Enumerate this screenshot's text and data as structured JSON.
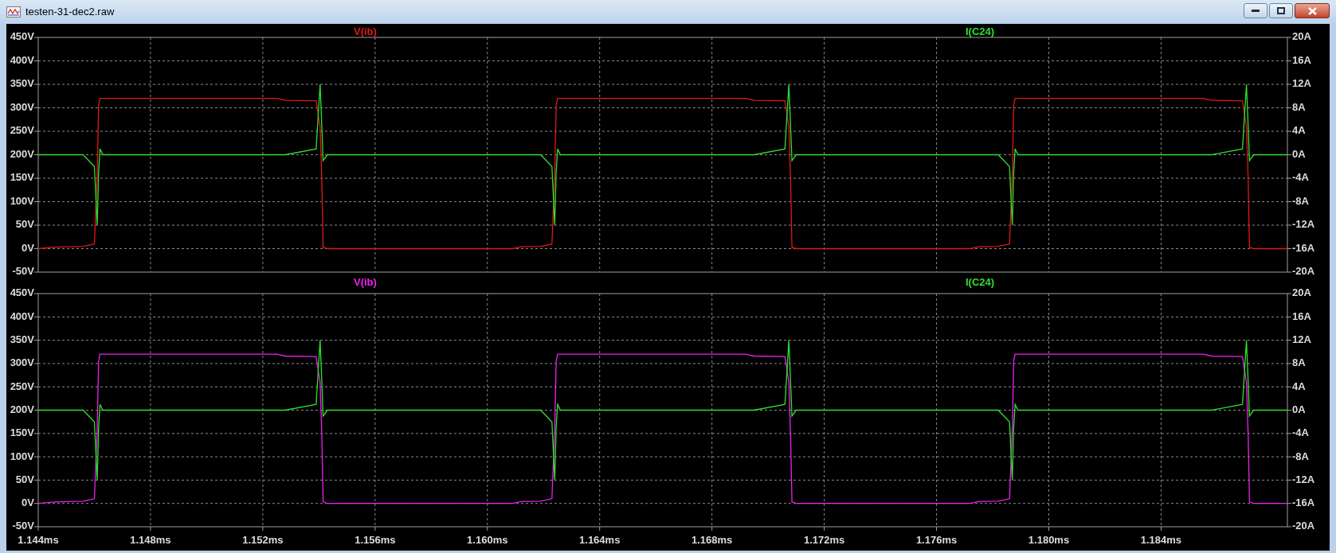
{
  "window": {
    "title": "testen-31-dec2.raw"
  },
  "panes": [
    {
      "chart_data": {
        "type": "line",
        "grid": true,
        "x": [
          1.144,
          1.1446,
          1.1456,
          1.146,
          1.1461,
          1.14615,
          1.1462,
          1.1463,
          1.1525,
          1.1528,
          1.1539,
          1.15404,
          1.1541,
          1.15415,
          1.1543,
          1.1609,
          1.1612,
          1.1619,
          1.1623,
          1.1624,
          1.16245,
          1.1625,
          1.1626,
          1.1692,
          1.1695,
          1.1706,
          1.17074,
          1.1708,
          1.17085,
          1.171,
          1.1772,
          1.1775,
          1.1782,
          1.1786,
          1.1787,
          1.17875,
          1.1788,
          1.1789,
          1.1855,
          1.1858,
          1.1869,
          1.18704,
          1.1871,
          1.18715,
          1.1873,
          1.1885
        ],
        "xlim": [
          1.144,
          1.1885
        ],
        "ylim": [
          -50,
          450
        ],
        "yticks": [
          {
            "value": 450,
            "label": "450V"
          },
          {
            "value": 400,
            "label": "400V"
          },
          {
            "value": 350,
            "label": "350V"
          },
          {
            "value": 300,
            "label": "300V"
          },
          {
            "value": 250,
            "label": "250V"
          },
          {
            "value": 200,
            "label": "200V"
          },
          {
            "value": 150,
            "label": "150V"
          },
          {
            "value": 100,
            "label": "100V"
          },
          {
            "value": 50,
            "label": "50V"
          },
          {
            "value": 0,
            "label": "0V"
          },
          {
            "value": -50,
            "label": "-50V"
          }
        ],
        "y2lim": [
          -20,
          20
        ],
        "y2ticks": [
          {
            "value": 20,
            "label": "20A"
          },
          {
            "value": 16,
            "label": "16A"
          },
          {
            "value": 12,
            "label": "12A"
          },
          {
            "value": 8,
            "label": "8A"
          },
          {
            "value": 4,
            "label": "4A"
          },
          {
            "value": 0,
            "label": "0A"
          },
          {
            "value": -4,
            "label": "-4A"
          },
          {
            "value": -8,
            "label": "-8A"
          },
          {
            "value": -12,
            "label": "-12A"
          },
          {
            "value": -16,
            "label": "-16A"
          },
          {
            "value": -20,
            "label": "-20A"
          }
        ],
        "series": [
          {
            "name": "V(ib)",
            "color": "#e01818",
            "values": [
              0,
              3,
              5,
              10,
              160,
              305,
              320,
              320,
              320,
              316,
              315,
              260,
              150,
              3,
              0,
              0,
              4,
              5,
              10,
              160,
              305,
              320,
              320,
              320,
              316,
              315,
              260,
              150,
              3,
              0,
              0,
              4,
              5,
              10,
              160,
              305,
              320,
              320,
              320,
              316,
              315,
              260,
              150,
              3,
              0,
              0
            ]
          },
          {
            "name": "I(C24)",
            "color": "#30e030",
            "axis": "y2",
            "values": [
              0,
              0,
              0,
              -2,
              -12,
              -3,
              1,
              0,
              0,
              0,
              1,
              12,
              5,
              -1,
              0,
              0,
              0,
              0,
              -2,
              -12,
              -3,
              1,
              0,
              0,
              0,
              1,
              12,
              5,
              -1,
              0,
              0,
              0,
              0,
              -2,
              -12,
              -3,
              1,
              0,
              0,
              0,
              1,
              12,
              5,
              -1,
              0,
              0
            ]
          }
        ]
      }
    },
    {
      "chart_data": {
        "type": "line",
        "x": [
          1.144,
          1.1446,
          1.1456,
          1.146,
          1.1461,
          1.14615,
          1.1462,
          1.1463,
          1.1525,
          1.1528,
          1.1539,
          1.15404,
          1.1541,
          1.15415,
          1.1543,
          1.1609,
          1.1612,
          1.1619,
          1.1623,
          1.1624,
          1.16245,
          1.1625,
          1.1626,
          1.1692,
          1.1695,
          1.1706,
          1.17074,
          1.1708,
          1.17085,
          1.171,
          1.1772,
          1.1775,
          1.1782,
          1.1786,
          1.1787,
          1.17875,
          1.1788,
          1.1789,
          1.1855,
          1.1858,
          1.1869,
          1.18704,
          1.1871,
          1.18715,
          1.1873,
          1.1885
        ],
        "grid": true,
        "xlim": [
          1.144,
          1.1885
        ],
        "xticks": [
          {
            "value": 1.144,
            "label": "1.144ms"
          },
          {
            "value": 1.148,
            "label": "1.148ms"
          },
          {
            "value": 1.152,
            "label": "1.152ms"
          },
          {
            "value": 1.156,
            "label": "1.156ms"
          },
          {
            "value": 1.16,
            "label": "1.160ms"
          },
          {
            "value": 1.164,
            "label": "1.164ms"
          },
          {
            "value": 1.168,
            "label": "1.168ms"
          },
          {
            "value": 1.172,
            "label": "1.172ms"
          },
          {
            "value": 1.176,
            "label": "1.176ms"
          },
          {
            "value": 1.18,
            "label": "1.180ms"
          },
          {
            "value": 1.184,
            "label": "1.184ms"
          }
        ],
        "ylim": [
          -50,
          450
        ],
        "yticks": [
          {
            "value": 450,
            "label": "450V"
          },
          {
            "value": 400,
            "label": "400V"
          },
          {
            "value": 350,
            "label": "350V"
          },
          {
            "value": 300,
            "label": "300V"
          },
          {
            "value": 250,
            "label": "250V"
          },
          {
            "value": 200,
            "label": "200V"
          },
          {
            "value": 150,
            "label": "150V"
          },
          {
            "value": 100,
            "label": "100V"
          },
          {
            "value": 50,
            "label": "50V"
          },
          {
            "value": 0,
            "label": "0V"
          },
          {
            "value": -50,
            "label": "-50V"
          }
        ],
        "y2lim": [
          -20,
          20
        ],
        "y2ticks": [
          {
            "value": 20,
            "label": "20A"
          },
          {
            "value": 16,
            "label": "16A"
          },
          {
            "value": 12,
            "label": "12A"
          },
          {
            "value": 8,
            "label": "8A"
          },
          {
            "value": 4,
            "label": "4A"
          },
          {
            "value": 0,
            "label": "0A"
          },
          {
            "value": -4,
            "label": "-4A"
          },
          {
            "value": -8,
            "label": "-8A"
          },
          {
            "value": -12,
            "label": "-12A"
          },
          {
            "value": -16,
            "label": "-16A"
          },
          {
            "value": -20,
            "label": "-20A"
          }
        ],
        "series": [
          {
            "name": "V(ib)",
            "color": "#f020f0",
            "values": [
              0,
              3,
              5,
              10,
              160,
              305,
              320,
              320,
              320,
              316,
              315,
              260,
              150,
              3,
              0,
              0,
              4,
              5,
              10,
              160,
              305,
              320,
              320,
              320,
              316,
              315,
              260,
              150,
              3,
              0,
              0,
              4,
              5,
              10,
              160,
              305,
              320,
              320,
              320,
              316,
              315,
              260,
              150,
              3,
              0,
              0
            ]
          },
          {
            "name": "I(C24)",
            "color": "#30e030",
            "axis": "y2",
            "values": [
              0,
              0,
              0,
              -2,
              -12,
              -3,
              1,
              0,
              0,
              0,
              1,
              12,
              5,
              -1,
              0,
              0,
              0,
              0,
              -2,
              -12,
              -3,
              1,
              0,
              0,
              0,
              1,
              12,
              5,
              -1,
              0,
              0,
              0,
              0,
              -2,
              -12,
              -3,
              1,
              0,
              0,
              0,
              1,
              12,
              5,
              -1,
              0,
              0
            ]
          }
        ]
      }
    }
  ]
}
